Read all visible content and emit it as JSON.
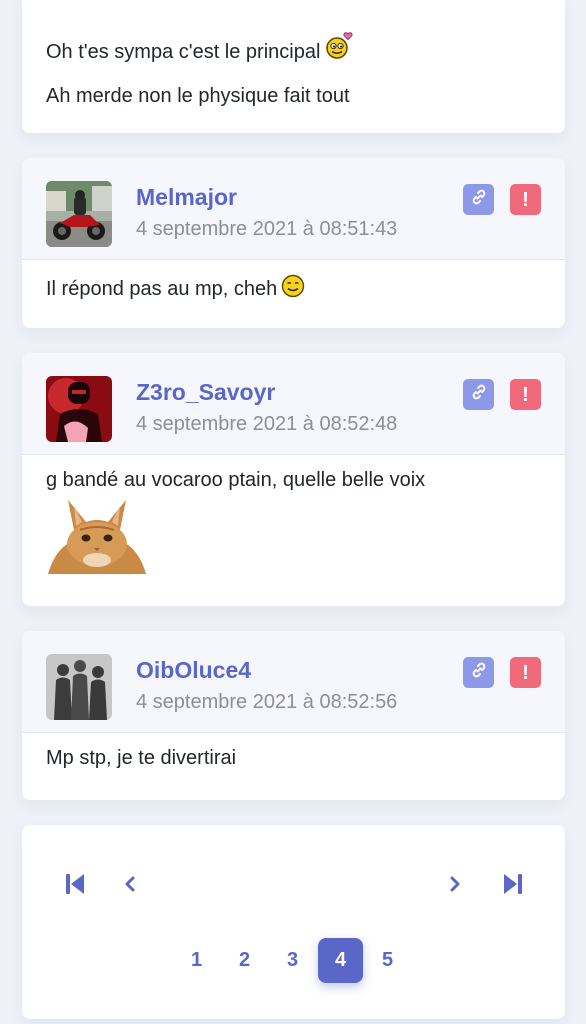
{
  "top_post": {
    "line1": "Oh t'es sympa c'est le principal",
    "line2": "Ah merde non le physique fait tout"
  },
  "posts": [
    {
      "username": "Melmajor",
      "date": "4 septembre 2021 à 08:51:43",
      "body": "Il répond pas au mp, cheh"
    },
    {
      "username": "Z3ro_Savoyr",
      "date": "4 septembre 2021 à 08:52:48",
      "body": "g bandé au vocaroo ptain, quelle belle voix"
    },
    {
      "username": "OibOluce4",
      "date": "4 septembre 2021 à 08:52:56",
      "body": "Mp stp, je te divertirai"
    }
  ],
  "pagination": {
    "pages": [
      "1",
      "2",
      "3",
      "4",
      "5"
    ],
    "current": "4"
  },
  "colors": {
    "accent": "#5a67c9",
    "link_button": "#8d99e8",
    "report_button": "#f06a7c",
    "background": "#eef1f7"
  },
  "icons": [
    "smiley-heart-icon",
    "smiley-icon",
    "link-icon",
    "report-icon",
    "first-page-icon",
    "prev-page-icon",
    "next-page-icon",
    "last-page-icon"
  ]
}
